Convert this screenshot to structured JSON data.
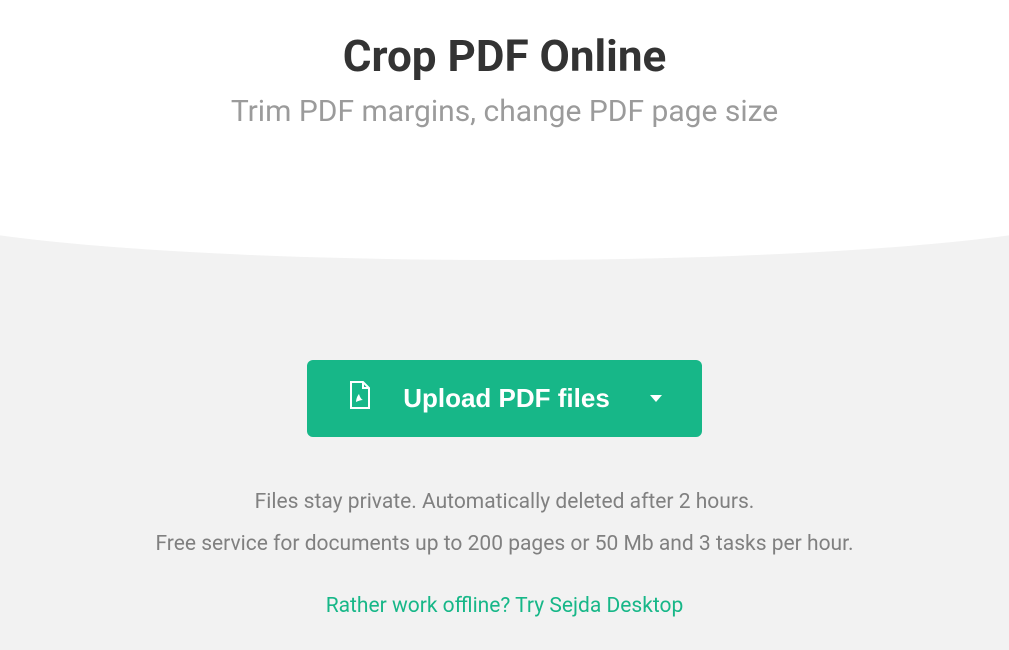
{
  "header": {
    "title": "Crop PDF Online",
    "subtitle": "Trim PDF margins, change PDF page size"
  },
  "upload": {
    "button_label": "Upload PDF files"
  },
  "info": {
    "line1": "Files stay private. Automatically deleted after 2 hours.",
    "line2": "Free service for documents up to 200 pages or 50 Mb and 3 tasks per hour."
  },
  "offline": {
    "prefix": "Rather work offline? ",
    "link_text": "Try Sejda Desktop"
  },
  "colors": {
    "accent": "#17b788",
    "title": "#333333",
    "subtitle": "#9b9b9b",
    "info_text": "#808080",
    "bg_gray": "#f2f2f2"
  }
}
